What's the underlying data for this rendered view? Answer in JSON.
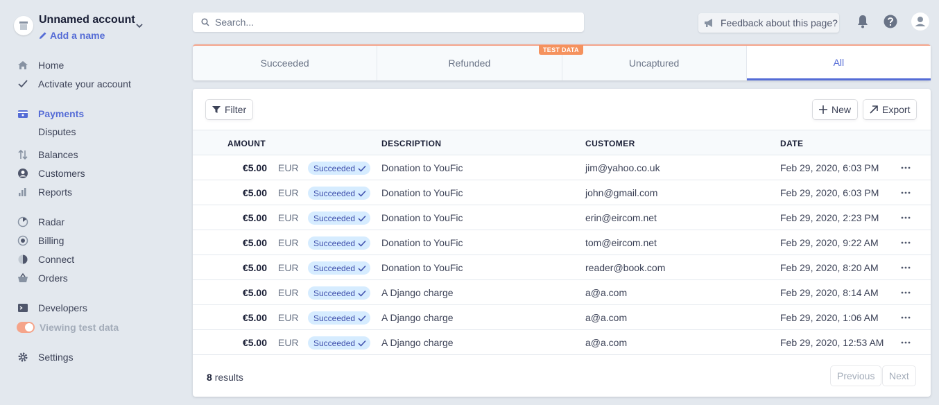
{
  "account": {
    "name": "Unnamed account",
    "add_name": "Add a name"
  },
  "nav": {
    "home": "Home",
    "activate": "Activate your account",
    "payments": "Payments",
    "disputes": "Disputes",
    "balances": "Balances",
    "customers": "Customers",
    "reports": "Reports",
    "radar": "Radar",
    "billing": "Billing",
    "connect": "Connect",
    "orders": "Orders",
    "developers": "Developers",
    "viewing_test_data": "Viewing test data",
    "settings": "Settings"
  },
  "search": {
    "placeholder": "Search..."
  },
  "feedback": "Feedback about this page?",
  "tabs": [
    "Succeeded",
    "Refunded",
    "Uncaptured",
    "All"
  ],
  "active_tab": "All",
  "test_badge": "TEST DATA",
  "toolbar": {
    "filter": "Filter",
    "new": "New",
    "export": "Export"
  },
  "columns": {
    "amount": "AMOUNT",
    "description": "DESCRIPTION",
    "customer": "CUSTOMER",
    "date": "DATE"
  },
  "rows": [
    {
      "amount": "€5.00",
      "currency": "EUR",
      "status": "Succeeded",
      "description": "Donation to YouFic",
      "customer": "jim@yahoo.co.uk",
      "date": "Feb 29, 2020, 6:03 PM"
    },
    {
      "amount": "€5.00",
      "currency": "EUR",
      "status": "Succeeded",
      "description": "Donation to YouFic",
      "customer": "john@gmail.com",
      "date": "Feb 29, 2020, 6:03 PM"
    },
    {
      "amount": "€5.00",
      "currency": "EUR",
      "status": "Succeeded",
      "description": "Donation to YouFic",
      "customer": "erin@eircom.net",
      "date": "Feb 29, 2020, 2:23 PM"
    },
    {
      "amount": "€5.00",
      "currency": "EUR",
      "status": "Succeeded",
      "description": "Donation to YouFic",
      "customer": "tom@eircom.net",
      "date": "Feb 29, 2020, 9:22 AM"
    },
    {
      "amount": "€5.00",
      "currency": "EUR",
      "status": "Succeeded",
      "description": "Donation to YouFic",
      "customer": "reader@book.com",
      "date": "Feb 29, 2020, 8:20 AM"
    },
    {
      "amount": "€5.00",
      "currency": "EUR",
      "status": "Succeeded",
      "description": "A Django charge",
      "customer": "a@a.com",
      "date": "Feb 29, 2020, 8:14 AM"
    },
    {
      "amount": "€5.00",
      "currency": "EUR",
      "status": "Succeeded",
      "description": "A Django charge",
      "customer": "a@a.com",
      "date": "Feb 29, 2020, 1:06 AM"
    },
    {
      "amount": "€5.00",
      "currency": "EUR",
      "status": "Succeeded",
      "description": "A Django charge",
      "customer": "a@a.com",
      "date": "Feb 29, 2020, 12:53 AM"
    }
  ],
  "results": {
    "count": "8",
    "label": "results"
  },
  "pagination": {
    "previous": "Previous",
    "next": "Next"
  },
  "colors": {
    "accent": "#556cd6",
    "test_mode": "#f5925e",
    "badge_bg": "#d6ecff"
  }
}
